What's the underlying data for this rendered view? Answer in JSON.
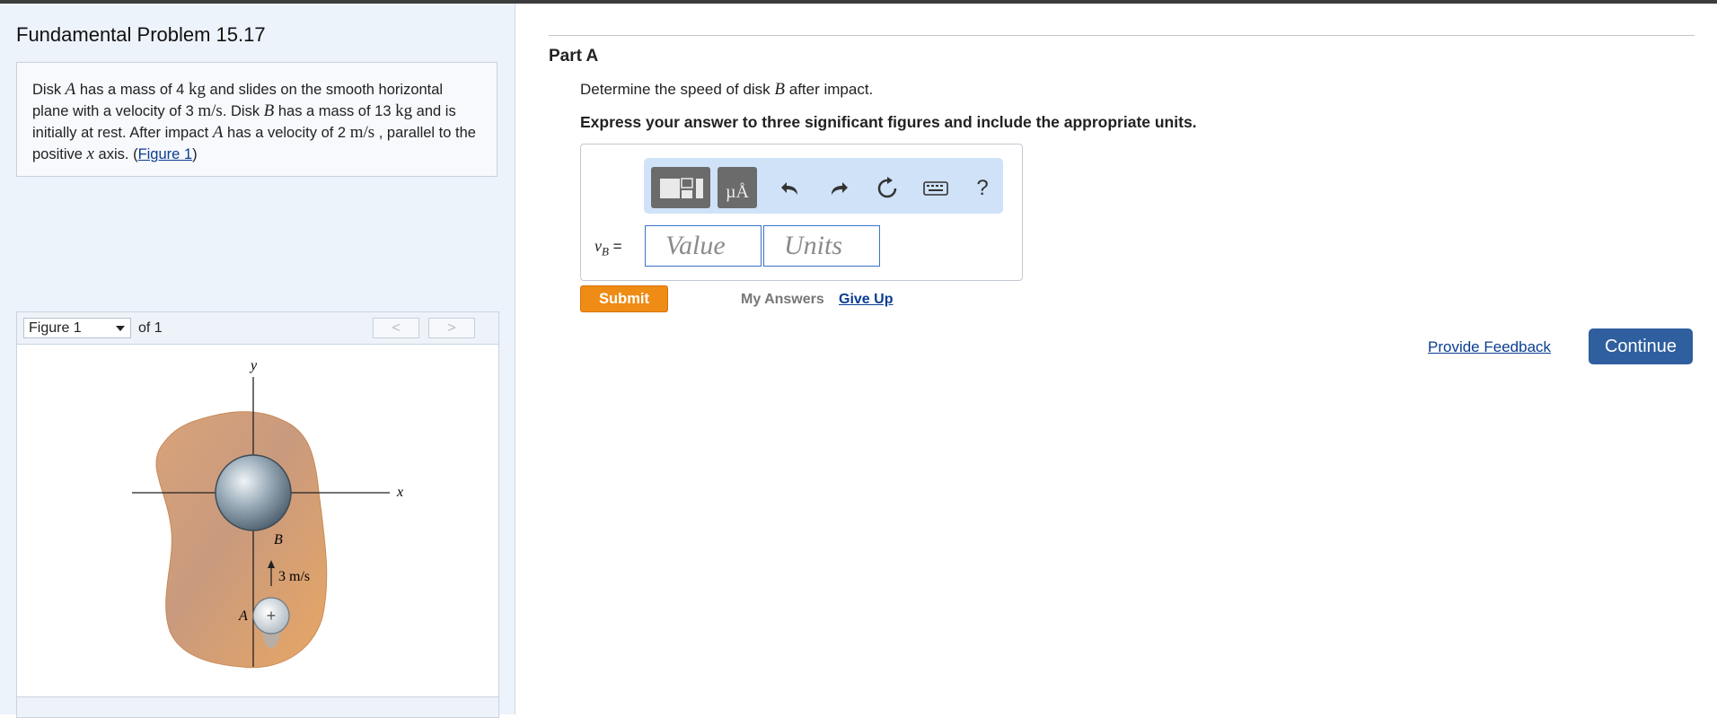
{
  "problem": {
    "title": "Fundamental Problem 15.17",
    "description": {
      "t1": "Disk ",
      "a1": "A",
      "t2": " has a mass of 4 ",
      "kg1": "kg",
      "t3": " and slides on the smooth horizontal plane with a velocity of 3 ",
      "ms1": "m/s",
      "t4": ". Disk ",
      "b1": "B",
      "t5": " has a mass of 13 ",
      "kg2": "kg",
      "t6": " and is initially at rest. After impact ",
      "a2": "A",
      "t7": " has a velocity of 2 ",
      "ms2": "m/s",
      "t8": " , parallel to the positive ",
      "x": "x",
      "t9": " axis. (",
      "figure_link": "Figure 1",
      "t10": ")"
    }
  },
  "figure_nav": {
    "selected": "Figure 1",
    "of_label": "of 1",
    "prev": "<",
    "next": ">"
  },
  "figure": {
    "y_label": "y",
    "x_label": "x",
    "b_label": "B",
    "a_label": "A",
    "velocity_label": "3 m/s"
  },
  "part": {
    "title": "Part A",
    "question": {
      "t1": "Determine the speed of disk ",
      "b": "B",
      "t2": " after impact."
    },
    "instruction": "Express your answer to three significant figures and include the appropriate units.",
    "variable": {
      "sym": "v",
      "sub": "B",
      "eq": " ="
    },
    "value_placeholder": "Value",
    "units_placeholder": "Units",
    "units_tool_label": "µÅ",
    "help_label": "?"
  },
  "actions": {
    "submit": "Submit",
    "my_answers": "My Answers",
    "give_up": "Give Up",
    "feedback": "Provide Feedback",
    "continue": "Continue"
  },
  "colors": {
    "submit": "#ef8c15",
    "continue": "#2f5f9e",
    "link": "#0b3d91",
    "toolbar": "#cfe2f7"
  }
}
